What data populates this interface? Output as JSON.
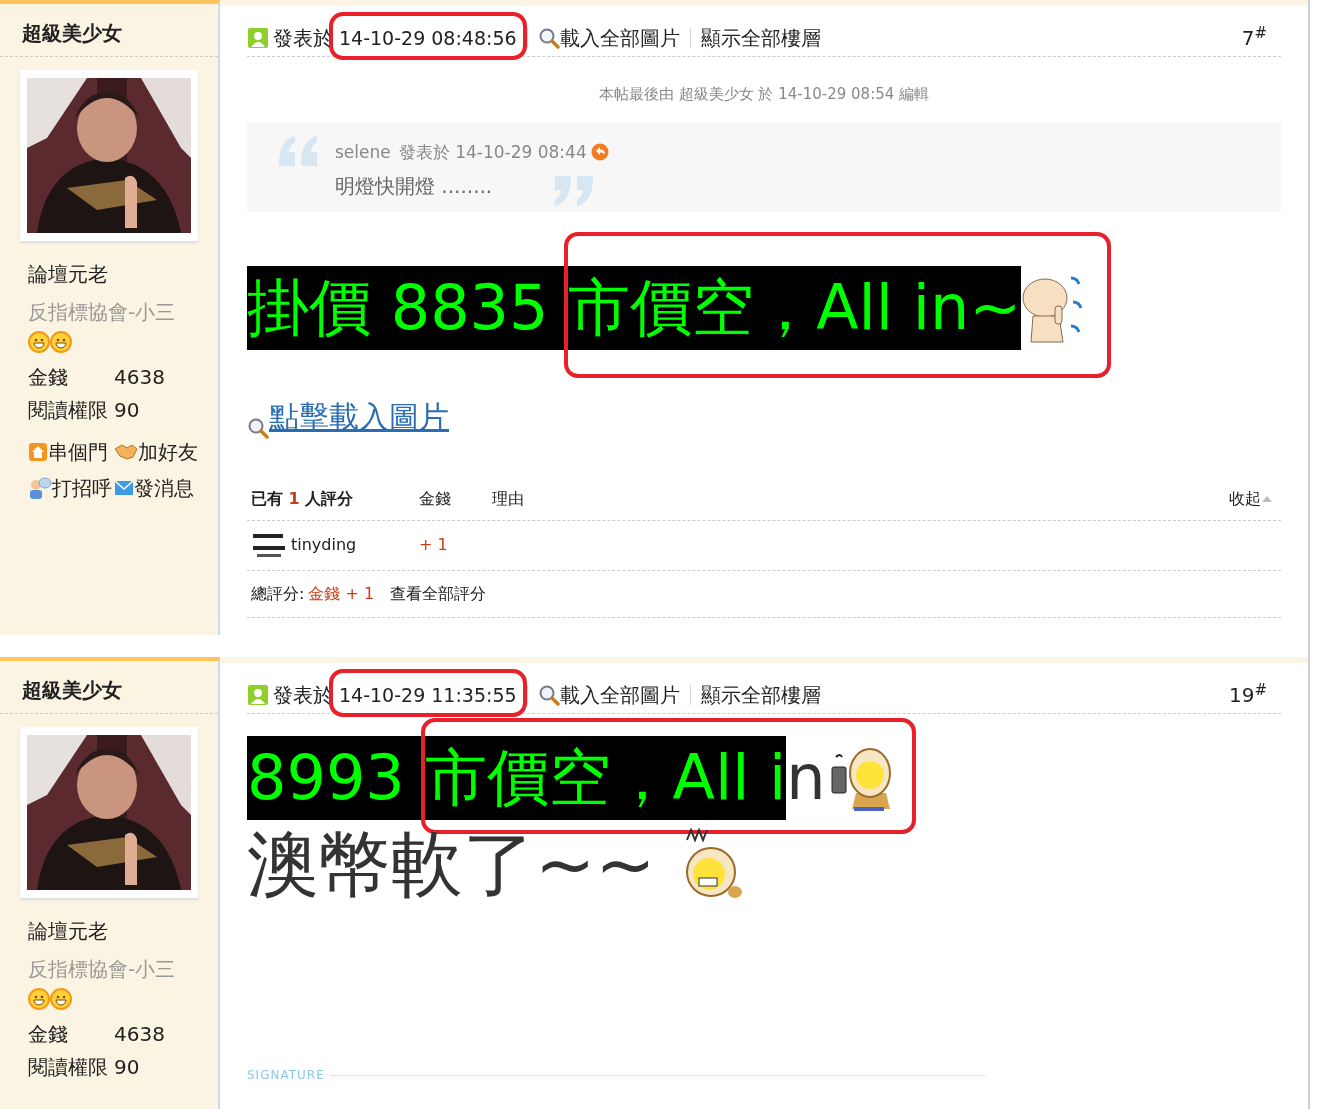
{
  "posts": [
    {
      "author": "超級美少女",
      "rank": "論壇元老",
      "group": "反指標協會-小三",
      "badges": [
        {
          "kind": "smiley"
        },
        {
          "kind": "smiley"
        }
      ],
      "stats": [
        {
          "label": "金錢",
          "value": "4638"
        },
        {
          "label": "閱讀權限",
          "value": "90"
        }
      ],
      "actions": [
        {
          "kind": "home",
          "label": "串個門"
        },
        {
          "kind": "friend",
          "label": "加好友"
        },
        {
          "kind": "greet",
          "label": "打招呼"
        },
        {
          "kind": "mail",
          "label": "發消息"
        }
      ],
      "meta": {
        "posted_label": "發表於",
        "timestamp": "14-10-29 08:48:56",
        "timestamp_circled": true,
        "load_images": "載入全部圖片",
        "show_all": "顯示全部樓層",
        "floor": "7",
        "floor_mark": "#"
      },
      "edit_note": "本帖最後由 超級美少女 於 14-10-29 08:54 編輯",
      "quote": {
        "author": "selene",
        "posted": "發表於 14-10-29 08:44",
        "text": "明燈快開燈 ........"
      },
      "lines": [
        {
          "kind": "banner",
          "parts": [
            {
              "circled": false,
              "runs": [
                {
                  "kind": "text",
                  "text": "掛價 8835 ",
                  "inverse": true
                }
              ]
            },
            {
              "circled": true,
              "runs": [
                {
                  "kind": "text",
                  "text": "市價空，All in~",
                  "inverse": true
                },
                {
                  "kind": "sticker-no"
                }
              ]
            }
          ]
        }
      ],
      "image_link": "點擊載入圖片",
      "ratings": {
        "count_prefix": "已有",
        "count": "1",
        "count_suffix": "人評分",
        "columns": [
          "金錢",
          "理由"
        ],
        "collapse": "收起",
        "rows": [
          {
            "user": "tinyding",
            "money": "+ 1"
          }
        ],
        "total_label": "總評分:",
        "total_value": "金錢 + 1",
        "view_all": "查看全部評分"
      }
    },
    {
      "author": "超級美少女",
      "rank": "論壇元老",
      "group": "反指標協會-小三",
      "badges": [
        {
          "kind": "smiley"
        },
        {
          "kind": "smiley"
        }
      ],
      "stats": [
        {
          "label": "金錢",
          "value": "4638"
        },
        {
          "label": "閱讀權限",
          "value": "90"
        }
      ],
      "meta": {
        "posted_label": "發表於",
        "timestamp": "14-10-29 11:35:55",
        "timestamp_circled": true,
        "load_images": "載入全部圖片",
        "show_all": "顯示全部樓層",
        "floor": "19",
        "floor_mark": "#"
      },
      "lines": [
        {
          "kind": "banner",
          "parts": [
            {
              "circled": false,
              "runs": [
                {
                  "kind": "text",
                  "text": "8993 ",
                  "inverse": true
                }
              ]
            },
            {
              "circled": true,
              "runs": [
                {
                  "kind": "text",
                  "text": "市價空，All i",
                  "inverse": true
                },
                {
                  "kind": "text",
                  "text": "n",
                  "inverse": false
                },
                {
                  "kind": "sticker-phone"
                }
              ]
            }
          ]
        },
        {
          "kind": "plain",
          "parts": [
            {
              "circled": false,
              "runs": [
                {
                  "kind": "text",
                  "text": "澳幣軟了~~ ",
                  "inverse": false
                },
                {
                  "kind": "sticker-shout"
                }
              ]
            }
          ]
        }
      ],
      "signature_label": "SIGNATURE"
    }
  ]
}
